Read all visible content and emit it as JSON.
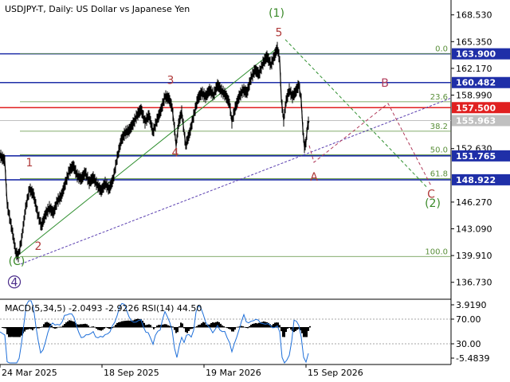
{
  "header": {
    "main_title": "USDJPY-T, Daily:  US Dollar vs Japanese Yen",
    "indicator_title": "MACD(5,34,5) -2.0493 -2.9226 RSI(14) 44.50"
  },
  "colors": {
    "background": "#ffffff",
    "price_line": "#000000",
    "level_blue": "#1f2fa8",
    "level_red": "#e02020",
    "fib_green": "#5a8f3a",
    "wave_brown": "#b03a3a",
    "wave_green": "#3b8a2a",
    "wave_purple": "#4a2c8a",
    "trend_green": "#2f8f2f",
    "trend_purple": "#5a3fb0",
    "forecast_green": "#2f8f2f",
    "forecast_red": "#b03a5a",
    "current_price_gray": "#c0c0c0"
  },
  "chart_data": {
    "type": "line",
    "title": "USDJPY-T, Daily:  US Dollar vs Japanese Yen",
    "xlabel": "",
    "ylabel": "",
    "ylim": [
      135.0,
      170.3
    ],
    "grid": false,
    "x_tick_labels": [
      "24 Mar 2025",
      "18 Sep 2025",
      "19 Mar 2026",
      "15 Sep 2026"
    ],
    "y_tick_labels": [
      "168.530",
      "165.350",
      "162.170",
      "158.990",
      "152.630",
      "146.270",
      "143.090",
      "139.910",
      "136.730"
    ],
    "price_points": [
      {
        "x": 0,
        "y": 151.8
      },
      {
        "x": 6,
        "y": 151.2
      },
      {
        "x": 9,
        "y": 146.0
      },
      {
        "x": 13,
        "y": 144.0
      },
      {
        "x": 16,
        "y": 142.5
      },
      {
        "x": 20,
        "y": 140.2
      },
      {
        "x": 23,
        "y": 139.9
      },
      {
        "x": 27,
        "y": 141.8
      },
      {
        "x": 32,
        "y": 145.5
      },
      {
        "x": 37,
        "y": 147.8
      },
      {
        "x": 42,
        "y": 147.2
      },
      {
        "x": 47,
        "y": 145.0
      },
      {
        "x": 52,
        "y": 143.4
      },
      {
        "x": 57,
        "y": 144.8
      },
      {
        "x": 62,
        "y": 145.6
      },
      {
        "x": 67,
        "y": 145.0
      },
      {
        "x": 72,
        "y": 146.4
      },
      {
        "x": 77,
        "y": 147.0
      },
      {
        "x": 82,
        "y": 148.5
      },
      {
        "x": 87,
        "y": 150.0
      },
      {
        "x": 92,
        "y": 150.6
      },
      {
        "x": 97,
        "y": 149.4
      },
      {
        "x": 102,
        "y": 149.0
      },
      {
        "x": 107,
        "y": 149.8
      },
      {
        "x": 112,
        "y": 148.6
      },
      {
        "x": 117,
        "y": 149.2
      },
      {
        "x": 122,
        "y": 148.3
      },
      {
        "x": 127,
        "y": 147.6
      },
      {
        "x": 132,
        "y": 148.5
      },
      {
        "x": 137,
        "y": 147.8
      },
      {
        "x": 142,
        "y": 149.0
      },
      {
        "x": 147,
        "y": 151.5
      },
      {
        "x": 152,
        "y": 153.6
      },
      {
        "x": 157,
        "y": 154.5
      },
      {
        "x": 162,
        "y": 154.8
      },
      {
        "x": 167,
        "y": 155.6
      },
      {
        "x": 172,
        "y": 156.6
      },
      {
        "x": 177,
        "y": 157.3
      },
      {
        "x": 182,
        "y": 155.8
      },
      {
        "x": 187,
        "y": 156.6
      },
      {
        "x": 192,
        "y": 154.6
      },
      {
        "x": 197,
        "y": 156.0
      },
      {
        "x": 202,
        "y": 157.2
      },
      {
        "x": 207,
        "y": 158.8
      },
      {
        "x": 212,
        "y": 158.6
      },
      {
        "x": 216,
        "y": 157.5
      },
      {
        "x": 219,
        "y": 155.0
      },
      {
        "x": 221,
        "y": 152.9
      },
      {
        "x": 224,
        "y": 155.6
      },
      {
        "x": 228,
        "y": 157.0
      },
      {
        "x": 233,
        "y": 153.0
      },
      {
        "x": 238,
        "y": 154.5
      },
      {
        "x": 243,
        "y": 156.5
      },
      {
        "x": 248,
        "y": 158.5
      },
      {
        "x": 253,
        "y": 159.3
      },
      {
        "x": 258,
        "y": 158.8
      },
      {
        "x": 263,
        "y": 159.6
      },
      {
        "x": 268,
        "y": 159.0
      },
      {
        "x": 273,
        "y": 160.2
      },
      {
        "x": 278,
        "y": 159.5
      },
      {
        "x": 283,
        "y": 159.0
      },
      {
        "x": 288,
        "y": 158.0
      },
      {
        "x": 291,
        "y": 155.8
      },
      {
        "x": 295,
        "y": 157.4
      },
      {
        "x": 300,
        "y": 158.8
      },
      {
        "x": 305,
        "y": 159.6
      },
      {
        "x": 310,
        "y": 159.3
      },
      {
        "x": 315,
        "y": 161.0
      },
      {
        "x": 320,
        "y": 162.0
      },
      {
        "x": 325,
        "y": 161.5
      },
      {
        "x": 330,
        "y": 162.8
      },
      {
        "x": 335,
        "y": 163.6
      },
      {
        "x": 340,
        "y": 162.6
      },
      {
        "x": 345,
        "y": 163.8
      },
      {
        "x": 348,
        "y": 164.6
      },
      {
        "x": 351,
        "y": 163.2
      },
      {
        "x": 353,
        "y": 158.5
      },
      {
        "x": 356,
        "y": 156.0
      },
      {
        "x": 359,
        "y": 158.3
      },
      {
        "x": 363,
        "y": 159.6
      },
      {
        "x": 367,
        "y": 158.8
      },
      {
        "x": 371,
        "y": 159.4
      },
      {
        "x": 375,
        "y": 160.2
      },
      {
        "x": 378,
        "y": 158.4
      },
      {
        "x": 380,
        "y": 155.0
      },
      {
        "x": 382,
        "y": 152.8
      },
      {
        "x": 384,
        "y": 153.4
      },
      {
        "x": 386,
        "y": 155.4
      },
      {
        "x": 388,
        "y": 155.9
      }
    ],
    "levels": [
      {
        "price_label": "163.900",
        "y": 163.9,
        "color": "#1f2fa8"
      },
      {
        "price_label": "160.482",
        "y": 160.482,
        "color": "#1f2fa8"
      },
      {
        "price_label": "157.500",
        "y": 157.5,
        "color": "#e02020"
      },
      {
        "price_label": "155.963",
        "y": 155.963,
        "color": "#c0c0c0"
      },
      {
        "price_label": "151.765",
        "y": 151.765,
        "color": "#1f2fa8"
      },
      {
        "price_label": "148.922",
        "y": 148.922,
        "color": "#1f2fa8"
      }
    ],
    "fib_levels": [
      {
        "label": "0.0",
        "y": 163.9
      },
      {
        "label": "23.6",
        "y": 158.2
      },
      {
        "label": "38.2",
        "y": 154.7
      },
      {
        "label": "50.0",
        "y": 151.9
      },
      {
        "label": "61.8",
        "y": 149.05
      },
      {
        "label": "100.0",
        "y": 139.8
      }
    ],
    "wave_labels": [
      {
        "text": "1",
        "x": 37,
        "y": 150.5,
        "color": "#b03a3a"
      },
      {
        "text": "2",
        "x": 48,
        "y": 140.6,
        "color": "#b03a3a"
      },
      {
        "text": "3",
        "x": 214,
        "y": 160.3,
        "color": "#b03a3a"
      },
      {
        "text": "4",
        "x": 220,
        "y": 151.7,
        "color": "#b03a3a"
      },
      {
        "text": "5",
        "x": 350,
        "y": 166.0,
        "color": "#b03a3a"
      },
      {
        "text": "(1)",
        "x": 347,
        "y": 168.3,
        "color": "#3b8a2a"
      },
      {
        "text": "(C)",
        "x": 21,
        "y": 138.8,
        "color": "#3b8a2a"
      },
      {
        "text": "4",
        "x": 18,
        "y": 136.3,
        "color": "#4a2c8a",
        "circled": true
      },
      {
        "text": "A",
        "x": 394,
        "y": 148.8,
        "color": "#b03a3a"
      },
      {
        "text": "B",
        "x": 483,
        "y": 160.0,
        "color": "#b03a5a"
      },
      {
        "text": "C",
        "x": 541,
        "y": 146.8,
        "color": "#b03a3a"
      },
      {
        "text": "(2)",
        "x": 543,
        "y": 145.7,
        "color": "#3b8a2a"
      }
    ],
    "y_axis_label_values": [
      168.53,
      165.35,
      162.17,
      158.99,
      152.63,
      146.27,
      143.09,
      139.91,
      136.73
    ],
    "x_axis_label_positions": [
      0,
      128,
      256,
      384
    ],
    "trend_lines": [
      {
        "name": "green-support",
        "style": "solid",
        "x1": 22,
        "y1": 139.9,
        "x2": 348,
        "y2": 164.6
      },
      {
        "name": "purple-support",
        "style": "dashed",
        "x1": 26,
        "y1": 138.9,
        "x2": 565,
        "y2": 158.6
      }
    ],
    "forecast_paths": [
      {
        "name": "green-forecast",
        "points": [
          {
            "x": 358,
            "y": 165.6
          },
          {
            "x": 536,
            "y": 148.0
          }
        ]
      },
      {
        "name": "red-forecast",
        "points": [
          {
            "x": 388,
            "y": 153.0
          },
          {
            "x": 394,
            "y": 151.0
          },
          {
            "x": 487,
            "y": 158.0
          },
          {
            "x": 541,
            "y": 148.2
          }
        ]
      }
    ],
    "indicator": {
      "macd": -2.0493,
      "signal": -2.9226,
      "rsi": 44.5,
      "macd_axis_labels": [
        "3.9190",
        "70.00",
        "30.00",
        "-5.4839"
      ],
      "rsi_levels": [
        70,
        30
      ]
    }
  }
}
